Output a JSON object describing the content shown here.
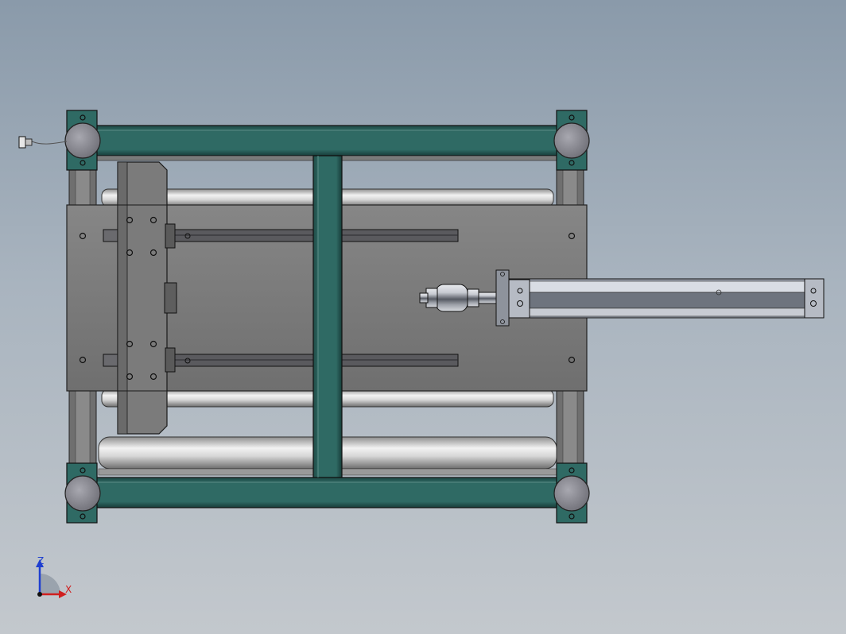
{
  "view": {
    "type": "cad-assembly-top-view",
    "background_top": "#8a9aaa",
    "background_bottom": "#c3c8cd",
    "frame_color": "#2e5f5a",
    "plate_color": "#7a7a7a",
    "roller_color": "#d0d0d0"
  },
  "triad": {
    "z_label": "Z",
    "x_label": "X",
    "z_color": "#1f3fd0",
    "x_color": "#d01f1f"
  }
}
